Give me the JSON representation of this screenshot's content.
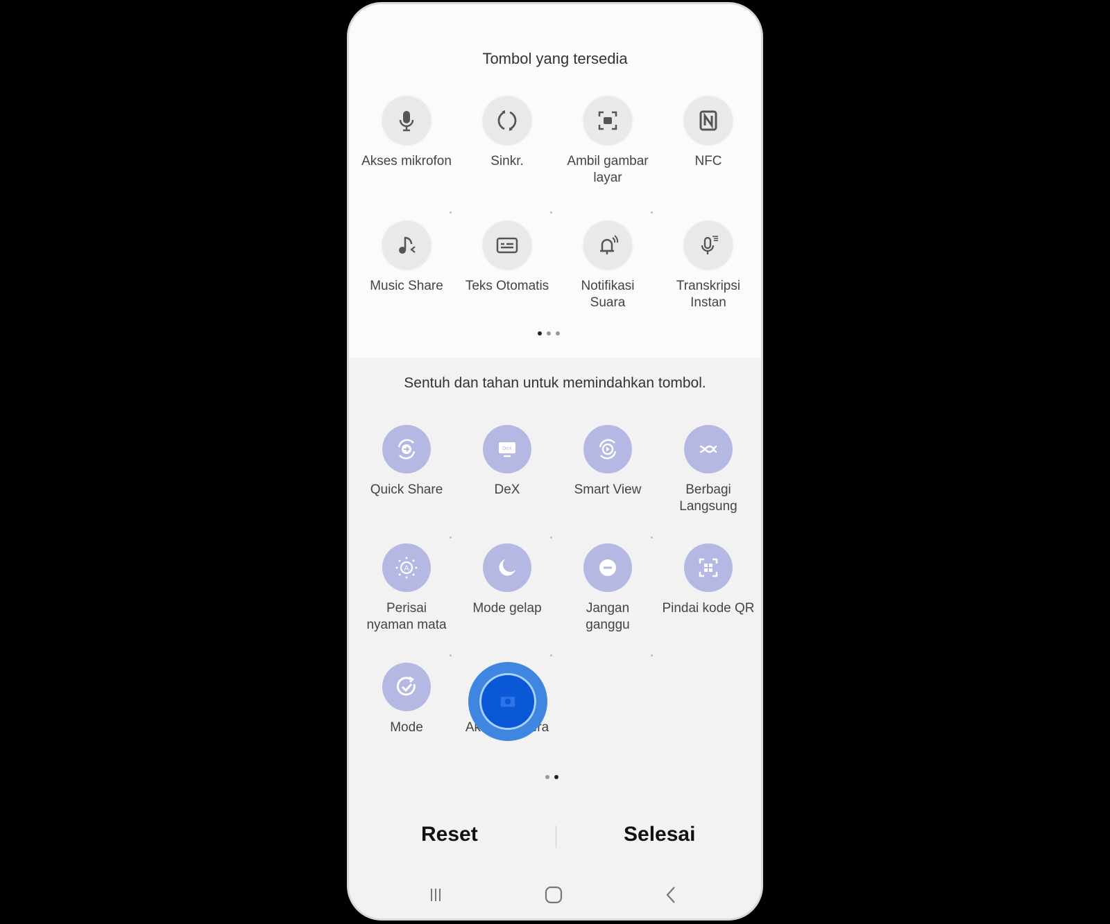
{
  "available": {
    "title": "Tombol yang tersedia",
    "items": [
      {
        "icon": "microphone-icon",
        "label": "Akses mikrofon"
      },
      {
        "icon": "sync-icon",
        "label": "Sinkr."
      },
      {
        "icon": "screenshot-icon",
        "label": "Ambil gambar\nlayar"
      },
      {
        "icon": "nfc-icon",
        "label": "NFC"
      },
      {
        "icon": "music-share-icon",
        "label": "Music Share"
      },
      {
        "icon": "live-caption-icon",
        "label": "Teks Otomatis"
      },
      {
        "icon": "sound-notification-icon",
        "label": "Notifikasi\nSuara"
      },
      {
        "icon": "live-transcribe-icon",
        "label": "Transkripsi\nInstan"
      }
    ],
    "pages": 3,
    "current_page": 1
  },
  "active": {
    "hint": "Sentuh dan tahan untuk memindahkan tombol.",
    "items": [
      {
        "icon": "quick-share-icon",
        "label": "Quick Share"
      },
      {
        "icon": "dex-icon",
        "label": "DeX"
      },
      {
        "icon": "smart-view-icon",
        "label": "Smart View"
      },
      {
        "icon": "direct-share-icon",
        "label": "Berbagi\nLangsung"
      },
      {
        "icon": "eye-comfort-icon",
        "label": "Perisai\nnyaman mata"
      },
      {
        "icon": "dark-mode-icon",
        "label": "Mode gelap"
      },
      {
        "icon": "do-not-disturb-icon",
        "label": "Jangan\nganggu"
      },
      {
        "icon": "qr-scan-icon",
        "label": "Pindai kode QR"
      },
      {
        "icon": "modes-icon",
        "label": "Mode"
      },
      {
        "icon": "camera-access-icon",
        "label": "Akses kamera",
        "dragging": true
      }
    ],
    "pages": 2,
    "current_page": 2
  },
  "footer": {
    "reset": "Reset",
    "done": "Selesai"
  },
  "colors": {
    "active_icon_bg": "#b5b8e3",
    "drag_ring": "#3f86e0",
    "drag_inner": "#0a58d6"
  }
}
